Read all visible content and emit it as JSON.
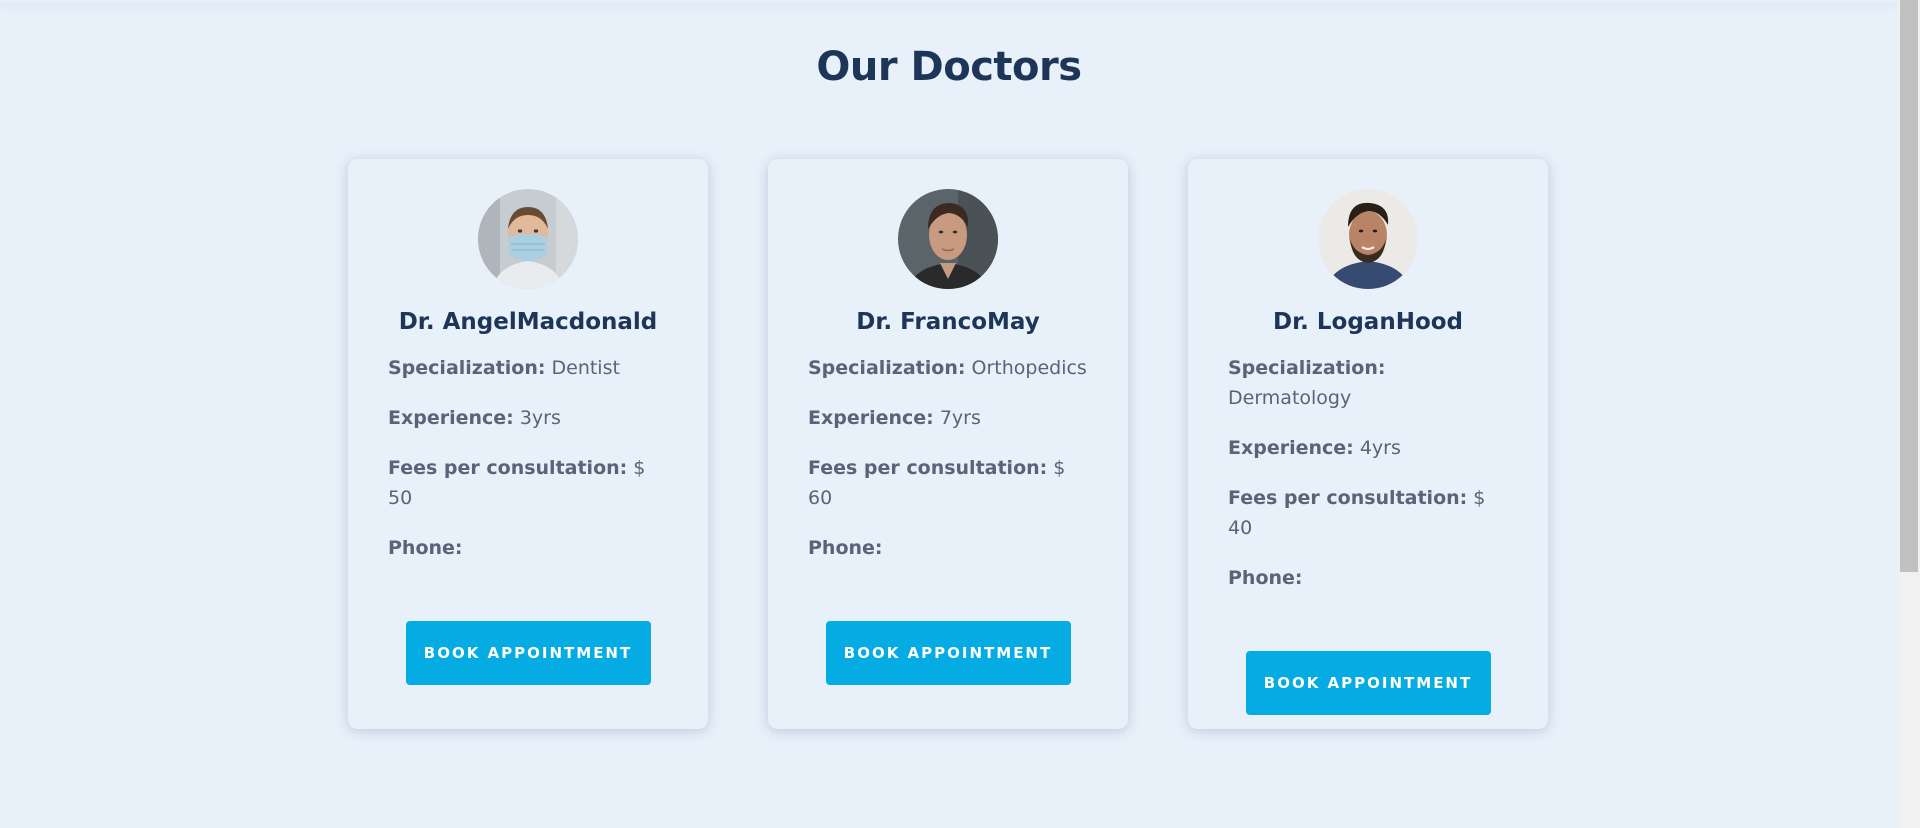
{
  "section": {
    "title": "Our Doctors"
  },
  "labels": {
    "specialization": "Specialization:",
    "experience": "Experience:",
    "fees": "Fees per consultation:",
    "phone": "Phone:"
  },
  "doctors": [
    {
      "name": "Dr. AngelMacdonald",
      "specialization": "Dentist",
      "experience": "3yrs",
      "fees": "$ 50",
      "phone": "",
      "button": "BOOK APPOINTMENT"
    },
    {
      "name": "Dr. FrancoMay",
      "specialization": "Orthopedics",
      "experience": "7yrs",
      "fees": "$ 60",
      "phone": "",
      "button": "BOOK APPOINTMENT"
    },
    {
      "name": "Dr. LoganHood",
      "specialization": "Dermatology",
      "experience": "4yrs",
      "fees": "$ 40",
      "phone": "",
      "button": "BOOK APPOINTMENT"
    }
  ],
  "colors": {
    "background": "#e8f0fa",
    "heading": "#1d3557",
    "body_text": "#5a6478",
    "button": "#04ace3",
    "button_text": "#ffffff"
  }
}
